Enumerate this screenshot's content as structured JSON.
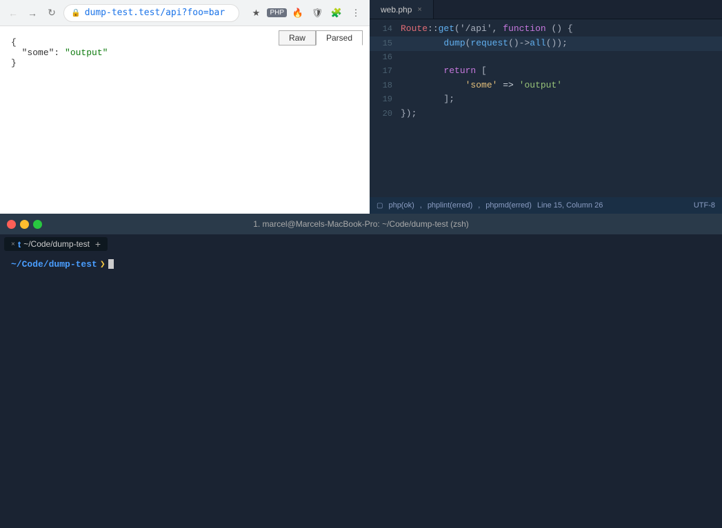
{
  "browser": {
    "url": "dump-test.test/api?foo=bar",
    "tab_raw": "Raw",
    "tab_parsed": "Parsed",
    "json_content": [
      {
        "line": "{"
      },
      {
        "line": "  \"some\": \"output\""
      },
      {
        "line": "}"
      }
    ],
    "php_badge": "PHP",
    "back_btn": "←",
    "forward_btn": "→",
    "reload_btn": "↻"
  },
  "editor": {
    "filename": "web.php",
    "close_label": "×",
    "lines": [
      {
        "num": "14",
        "content": "Route::get('/api', function () {",
        "highlighted": false
      },
      {
        "num": "15",
        "content": "        dump(request()->all());",
        "highlighted": true
      },
      {
        "num": "16",
        "content": "",
        "highlighted": false
      },
      {
        "num": "17",
        "content": "        return [",
        "highlighted": false
      },
      {
        "num": "18",
        "content": "            'some' => 'output'",
        "highlighted": false
      },
      {
        "num": "19",
        "content": "        ];",
        "highlighted": false
      },
      {
        "num": "20",
        "content": "});",
        "highlighted": false
      }
    ],
    "status_bar": {
      "php_ok": "php(ok)",
      "phplint_err": "phplint(erred)",
      "phpmd_err": "phpmd(erred)",
      "position": "Line 15, Column 26",
      "encoding": "UTF-8"
    }
  },
  "terminal": {
    "title": "1. marcel@Marcels-MacBook-Pro: ~/Code/dump-test (zsh)",
    "tab_label": "~/Code/dump-test",
    "traffic_lights": {
      "red": "close",
      "yellow": "minimize",
      "green": "maximize"
    },
    "t_icon": "t",
    "x_icon": "×",
    "plus_icon": "+"
  }
}
